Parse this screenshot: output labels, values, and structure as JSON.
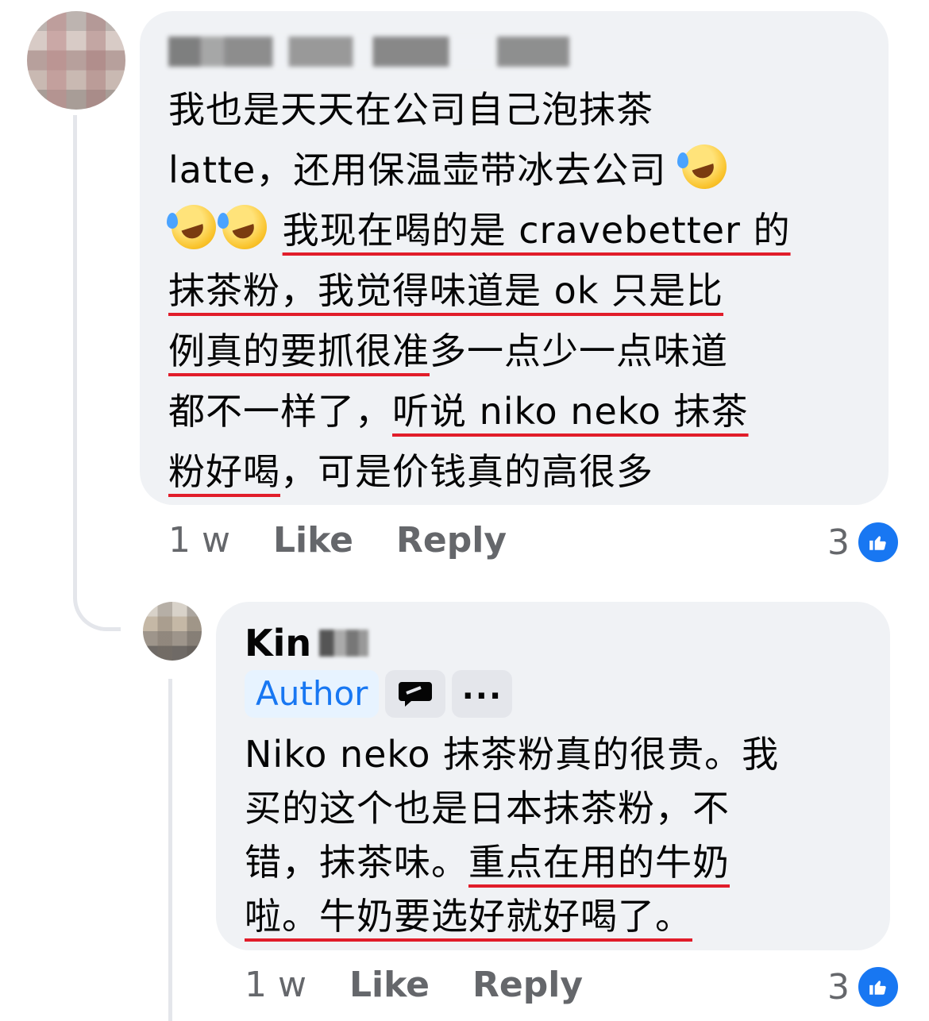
{
  "comment_1": {
    "text_plain_1": "我也是天天在公司自己泡抹茶",
    "text_plain_2": "latte，还用保温壶带冰去公司 ",
    "text_underlined_1": "我现在喝的是 cravebetter 的",
    "text_underlined_2": "抹茶粉，我觉得味道是 ok 只是比",
    "text_underlined_3": "例真的要抓很准",
    "text_plain_3": "多一点少一点味道",
    "text_plain_4": "都不一样了，",
    "text_underlined_4": "听说 niko neko 抹茶",
    "text_underlined_5": "粉好喝",
    "text_plain_5": "，可是价钱真的高很多",
    "time": "1 w",
    "like_label": "Like",
    "reply_label": "Reply",
    "reaction_count": "3"
  },
  "comment_2": {
    "author_name": "Kin",
    "author_badge": "Author",
    "more_label": "...",
    "text_plain_1": "Niko neko 抹茶粉真的很贵。我",
    "text_plain_2": "买的这个也是日本抹茶粉，不",
    "text_plain_3": "错，抹茶味。",
    "text_underlined_1": "重点在用的牛奶",
    "text_underlined_2": "啦。牛奶要选好就好喝了。",
    "time": "1 w",
    "like_label": "Like",
    "reply_label": "Reply",
    "reaction_count": "3"
  },
  "icons": {
    "reaction": "like-thumbs-up-icon",
    "emoji": "rolling-on-floor-laughing-emoji",
    "message": "message-bubble-icon",
    "more": "more-dots-icon"
  },
  "colors": {
    "bubble_bg": "#f0f2f5",
    "underline": "#e11d2a",
    "facebook_blue": "#1877f2",
    "secondary_text": "#65676b"
  }
}
